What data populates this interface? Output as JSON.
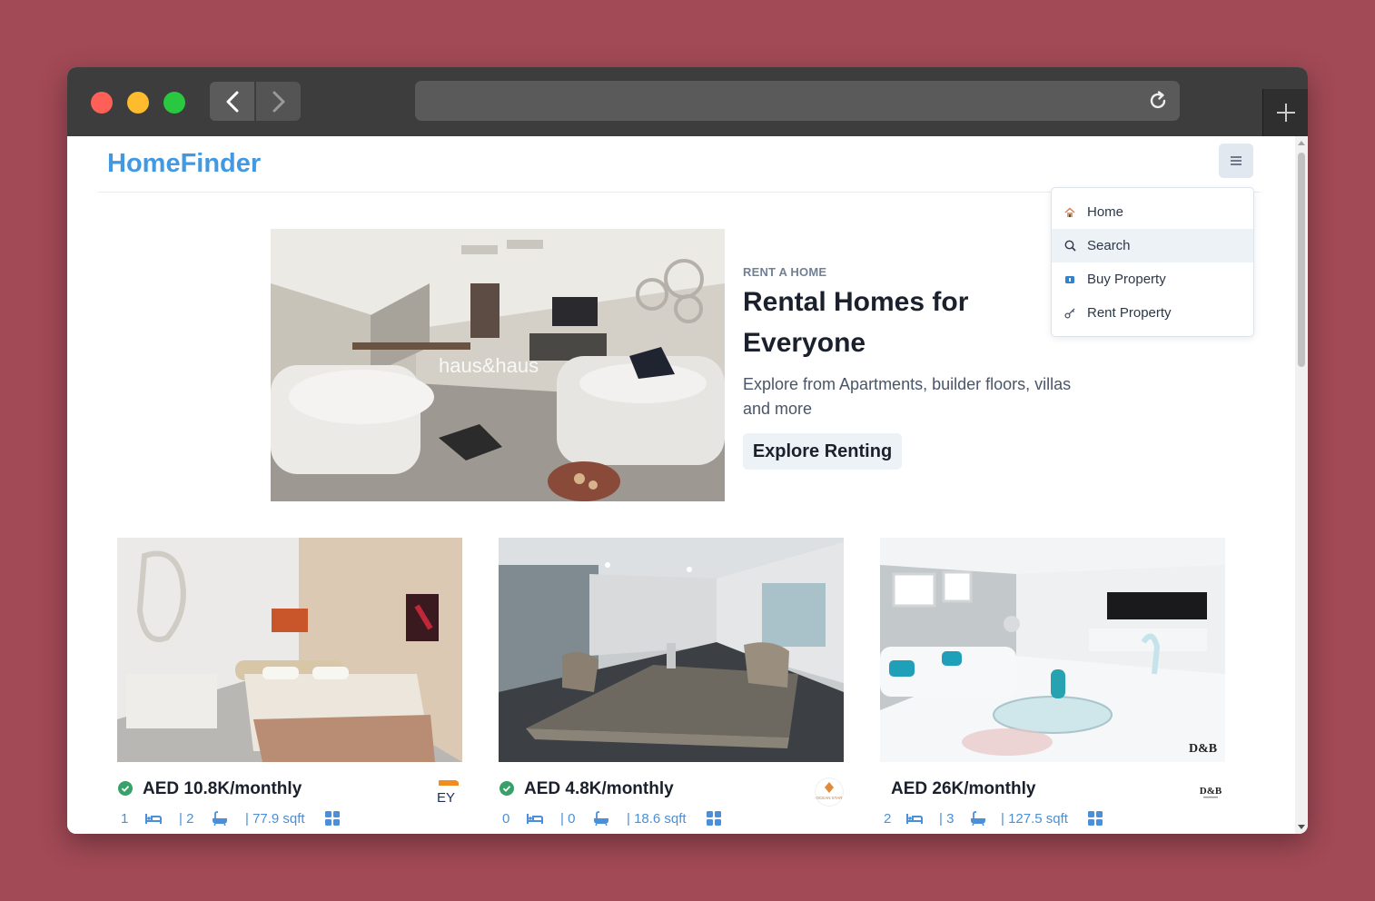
{
  "browser": {
    "url": "",
    "back_icon": "chevron-left-icon",
    "forward_icon": "chevron-right-icon",
    "reload_icon": "reload-icon",
    "new_tab_icon": "plus-icon"
  },
  "site": {
    "brand": "HomeFinder",
    "menu_icon": "hamburger-icon",
    "colors": {
      "brand": "#4299e1",
      "accent": "#4a8fd8",
      "verified": "#38a169"
    }
  },
  "menu": {
    "items": [
      {
        "label": "Home",
        "icon": "home-icon"
      },
      {
        "label": "Search",
        "icon": "search-icon",
        "active": true
      },
      {
        "label": "Buy Property",
        "icon": "buy-icon"
      },
      {
        "label": "Rent Property",
        "icon": "key-icon"
      }
    ]
  },
  "hero": {
    "eyebrow": "RENT A HOME",
    "title": "Rental Homes for Everyone",
    "description": "Explore from Apartments, builder floors, villas and more",
    "cta": "Explore Renting",
    "image_watermark": "haus&haus"
  },
  "listings": [
    {
      "verified": true,
      "price": "AED 10.8K/monthly",
      "rooms": "1",
      "baths": "| 2",
      "area": "| 77.9 sqft",
      "agency_logo": "EY"
    },
    {
      "verified": true,
      "price": "AED 4.8K/monthly",
      "rooms": "0",
      "baths": "| 0",
      "area": "| 18.6 sqft",
      "agency_logo": "OCEAN STAR"
    },
    {
      "verified": false,
      "price": "AED 26K/monthly",
      "rooms": "2",
      "baths": "| 3",
      "area": "| 127.5 sqft",
      "agency_logo": "D&B"
    }
  ]
}
